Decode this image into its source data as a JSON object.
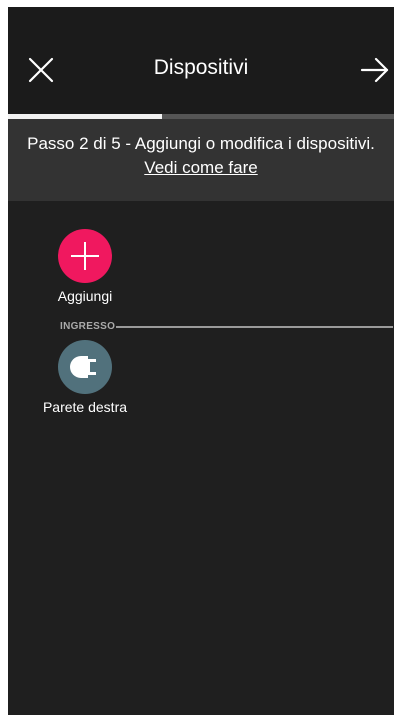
{
  "header": {
    "title": "Dispositivi",
    "close_icon": "close-icon",
    "next_icon": "arrow-right-icon"
  },
  "progress": {
    "current_step": 2,
    "total_steps": 5,
    "fraction": 0.4
  },
  "banner": {
    "step_text": "Passo 2 di 5 - Aggiungi o modifica i dispositivi.",
    "help_link": "Vedi come fare"
  },
  "add_tile": {
    "label": "Aggiungi",
    "icon": "plus-icon",
    "color": "#f0185f"
  },
  "section": {
    "label": "INGRESSO"
  },
  "devices": [
    {
      "label": "Parete destra",
      "icon": "plug-icon",
      "color": "#51717c"
    }
  ],
  "colors": {
    "background": "#1f1f1f",
    "header": "#1b1b1b",
    "banner": "#333333",
    "progress_track": "#555555",
    "progress_fill": "#f2f2f2"
  }
}
